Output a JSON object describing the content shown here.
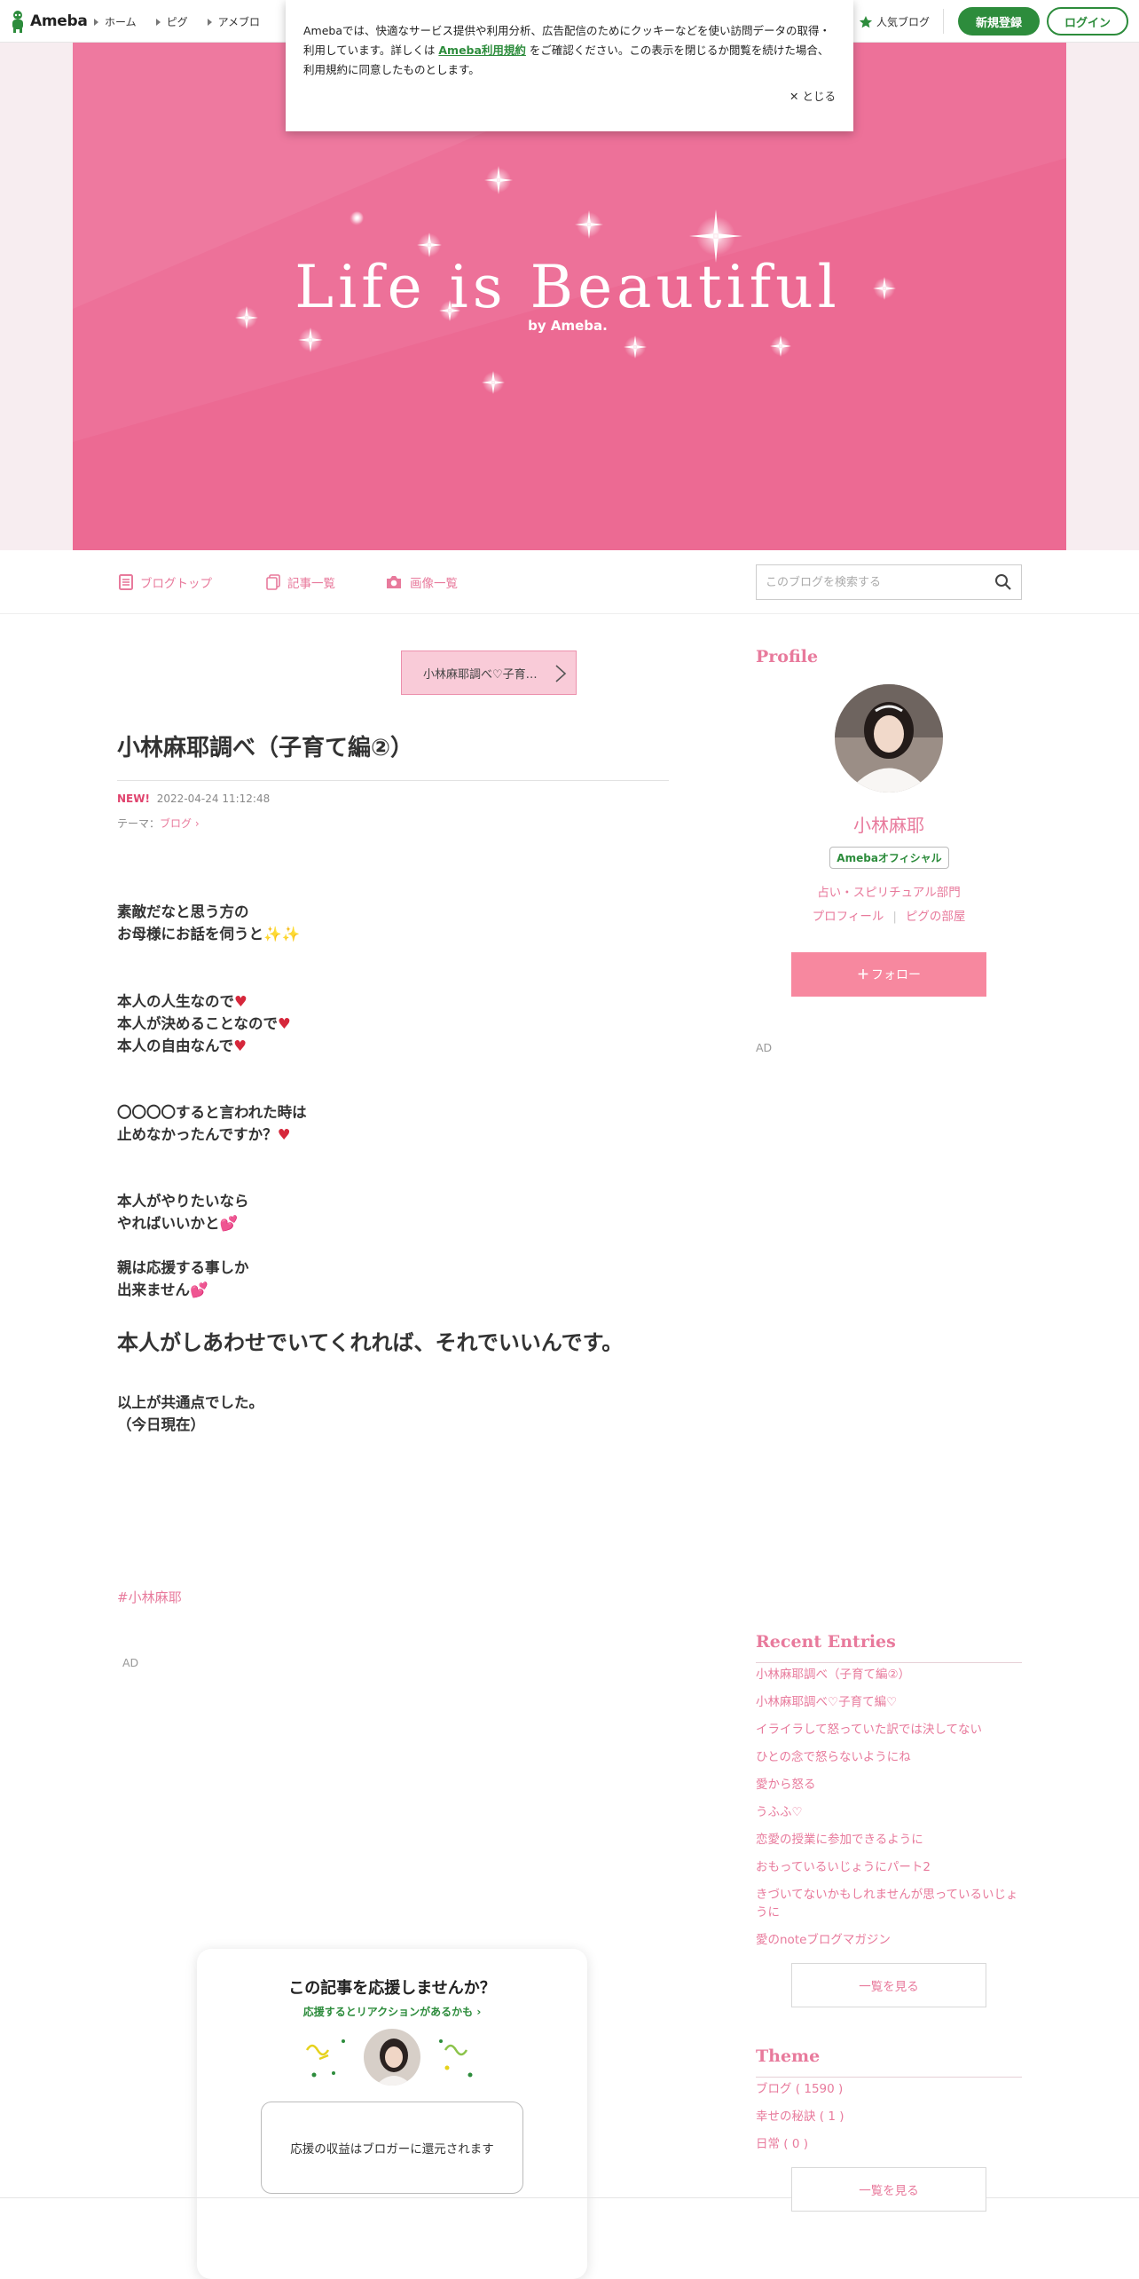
{
  "header": {
    "logo_text": "Ameba",
    "nav": [
      "ホーム",
      "ピグ",
      "アメブロ"
    ],
    "popular": "人気ブログ",
    "signup": "新規登録",
    "login": "ログイン"
  },
  "cookie": {
    "text_before": "Amebaでは、快適なサービス提供や利用分析、広告配信のためにクッキーなどを使い訪問データの取得・利用しています。詳しくは",
    "link": "Ameba利用規約",
    "text_after": "をご確認ください。この表示を閉じるか閲覧を続けた場合、利用規約に同意したものとします。",
    "close": "とじる"
  },
  "hero": {
    "title": "Life is Beautiful",
    "byline": "by Ameba."
  },
  "blognav": {
    "top": "ブログトップ",
    "entries": "記事一覧",
    "images": "画像一覧",
    "search_placeholder": "このブログを検索する"
  },
  "article": {
    "prev_label": "小林麻耶調べ♡子育…",
    "title": "小林麻耶調べ（子育て編②）",
    "new_badge": "NEW!",
    "datetime": "2022-04-24 11:12:48",
    "theme_label": "テーマ：",
    "theme": "ブログ",
    "lines": {
      "l1": "素敵だなと思う方の",
      "l2": "お母様にお話を伺うと",
      "l3": "本人の人生なので",
      "l4": "本人が決めることなので",
      "l5": "本人の自由なんで",
      "l6": "〇〇〇〇すると言われた時は",
      "l7": "止めなかったんですか？",
      "l8": "本人がやりたいなら",
      "l9": "やればいいかと",
      "l10": "親は応援する事しか",
      "l11": "出来ません",
      "big": "本人がしあわせでいてくれれば、それでいいんです。",
      "l12": "以上が共通点でした。",
      "l13": "（今日現在）"
    },
    "hashtag": "#小林麻耶",
    "ad": "AD"
  },
  "support": {
    "title": "この記事を応援しませんか？",
    "sub": "応援するとリアクションがあるかも",
    "box": "応援の収益はブロガーに還元されます"
  },
  "sidebar": {
    "profile_heading": "Profile",
    "name": "小林麻耶",
    "official": "Amebaオフィシャル",
    "category": "占い・スピリチュアル部門",
    "profile_link": "プロフィール",
    "pigg_link": "ピグの部屋",
    "follow": "フォロー",
    "ad": "AD",
    "recent_heading": "Recent Entries",
    "recent": [
      "小林麻耶調べ（子育て編②）",
      "小林麻耶調べ♡子育て編♡",
      "イライラして怒っていた訳では決してない",
      "ひとの念で怒らないようにね",
      "愛から怒る",
      "うふふ♡",
      "恋愛の授業に参加できるように",
      "おもっているいじょうにパート2",
      "きづいてないかもしれませんが思っているいじょうに",
      "愛のnoteブログマガジン"
    ],
    "list_more": "一覧を見る",
    "theme_heading": "Theme",
    "themes": [
      "ブログ ( 1590 )",
      "幸せの秘訣 ( 1 )",
      "日常 ( 0 )"
    ],
    "theme_more": "一覧を見る"
  },
  "colors": {
    "accent_pink": "#e87a9c",
    "hero_pink": "#ec6a93",
    "ameba_green": "#2d8c3c"
  }
}
